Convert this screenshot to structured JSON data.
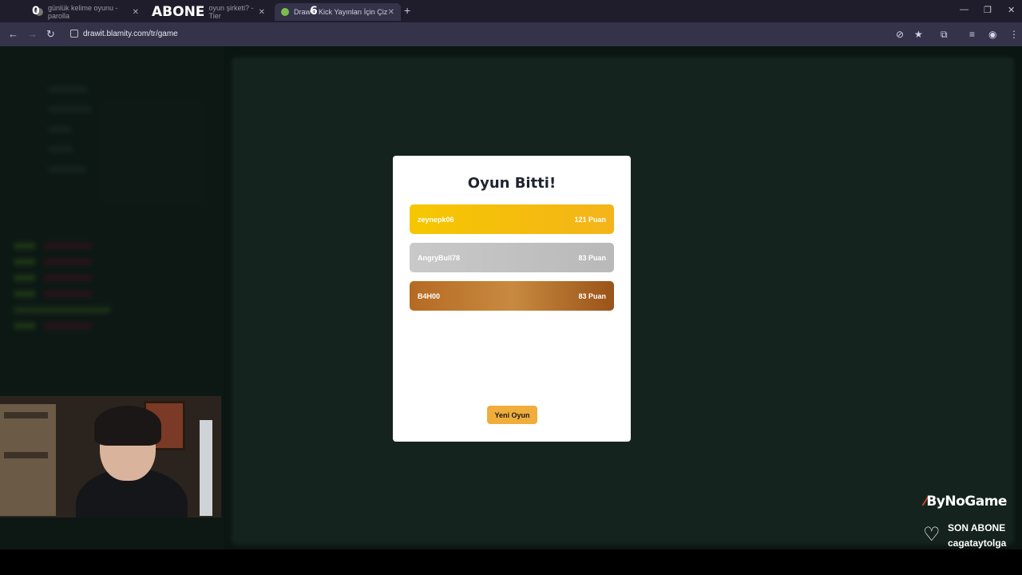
{
  "browser": {
    "tabs": [
      {
        "label": "günlük kelime oyunu - parolla",
        "active": false
      },
      {
        "label": "oyun şirketi? - Tier",
        "active": false
      },
      {
        "label": "Draw 6 Kick Yayınları İçin Çiz",
        "active": true
      }
    ],
    "overlay_counts": {
      "first": "0",
      "second": "6"
    },
    "overlay_abone": "ABONE",
    "url": "drawit.blamity.com/tr/game"
  },
  "modal": {
    "title": "Oyun Bitti!",
    "rankings": [
      {
        "name": "zeynepk06",
        "score": "121 Puan",
        "tier": "gold"
      },
      {
        "name": "AngryBull78",
        "score": "83 Puan",
        "tier": "silver"
      },
      {
        "name": "B4H00",
        "score": "83 Puan",
        "tier": "bronze"
      }
    ],
    "new_game_label": "Yeni Oyun"
  },
  "stream_overlay": {
    "brand": "ByNoGame",
    "last_sub_title": "SON ABONE",
    "last_sub_name": "cagataytolga"
  },
  "colors": {
    "gold": "#f6c700",
    "silver": "#c4c4c4",
    "bronze": "#b56a22",
    "button": "#f0ad3c"
  }
}
